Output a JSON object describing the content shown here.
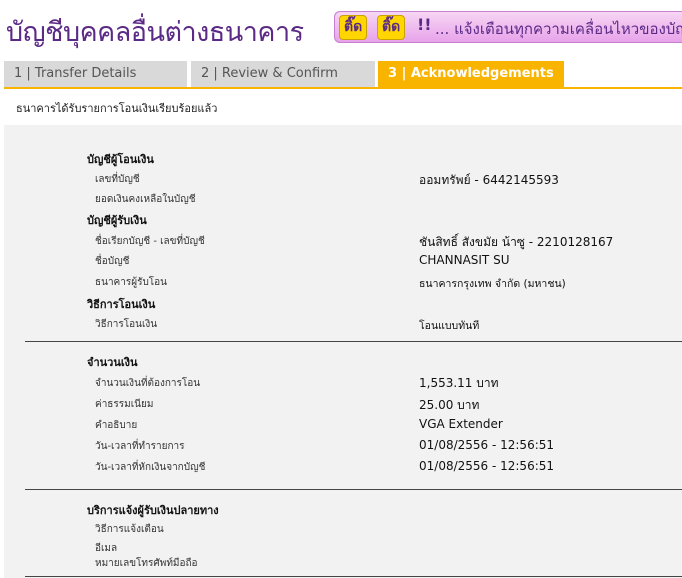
{
  "header": {
    "title": "บัญชีบุคคลอื่นต่างธนาคาร",
    "banner_badge1": "ติ๊ด",
    "banner_badge2": "ติ๊ด",
    "banner_bang": "!!",
    "banner_text": "... แจ้งเตือนทุกความเคลื่อนไหวของบัญ"
  },
  "tabs": [
    {
      "label": "1 | Transfer Details"
    },
    {
      "label": "2 | Review & Confirm"
    },
    {
      "label": "3 | Acknowledgements"
    }
  ],
  "message": "ธนาคารได้รับรายการโอนเงินเรียบร้อยแล้ว",
  "from_account": {
    "heading": "บัญชีผู้โอนเงิน",
    "account_no_label": "เลขที่บัญชี",
    "account_no_value": "ออมทรัพย์ - 6442145593",
    "balance_label": "ยอดเงินคงเหลือในบัญชี"
  },
  "to_account": {
    "heading": "บัญชีผู้รับเงิน",
    "nickname_label": "ชื่อเรียกบัญชี - เลขที่บัญชี",
    "nickname_value": "ชันสิทธิ์ สังขมัย น้าซู - 2210128167",
    "name_label": "ชื่อบัญชี",
    "name_value": "CHANNASIT SU",
    "bank_label": "ธนาคารผู้รับโอน",
    "bank_value": "ธนาคารกรุงเทพ จำกัด (มหาชน)"
  },
  "transfer_method": {
    "heading": "วิธีการโอนเงิน",
    "label": "วิธีการโอนเงิน",
    "value": "โอนแบบทันที"
  },
  "amount": {
    "heading": "จำนวนเงิน",
    "amount_label": "จำนวนเงินที่ต้องการโอน",
    "amount_value": "1,553.11 บาท",
    "fee_label": "ค่าธรรมเนียม",
    "fee_value": "25.00 บาท",
    "desc_label": "คำอธิบาย",
    "desc_value": "VGA Extender",
    "txn_time_label": "วัน-เวลาที่ทำรายการ",
    "txn_time_value": "01/08/2556 - 12:56:51",
    "debit_time_label": "วัน-เวลาที่หักเงินจากบัญชี",
    "debit_time_value": "01/08/2556 - 12:56:51"
  },
  "notify": {
    "heading": "บริการแจ้งผู้รับเงินปลายทาง",
    "method_label": "วิธีการแจ้งเตือน",
    "email_label": "อีเมล",
    "phone_label": "หมายเลขโทรศัพท์มือถือ"
  },
  "colors": {
    "accent": "#f9b400",
    "title": "#5b2a86",
    "panel": "#f2f2f2"
  }
}
